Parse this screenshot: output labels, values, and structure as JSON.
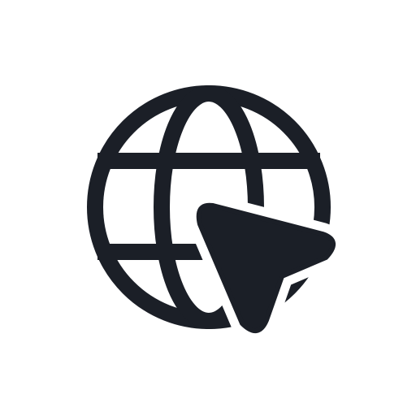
{
  "icon": {
    "name": "web-cursor-icon",
    "parts": [
      "globe-icon",
      "pointer-cursor-icon"
    ]
  },
  "colors": {
    "background": "#ffffff",
    "foreground": "#1b1f27"
  }
}
